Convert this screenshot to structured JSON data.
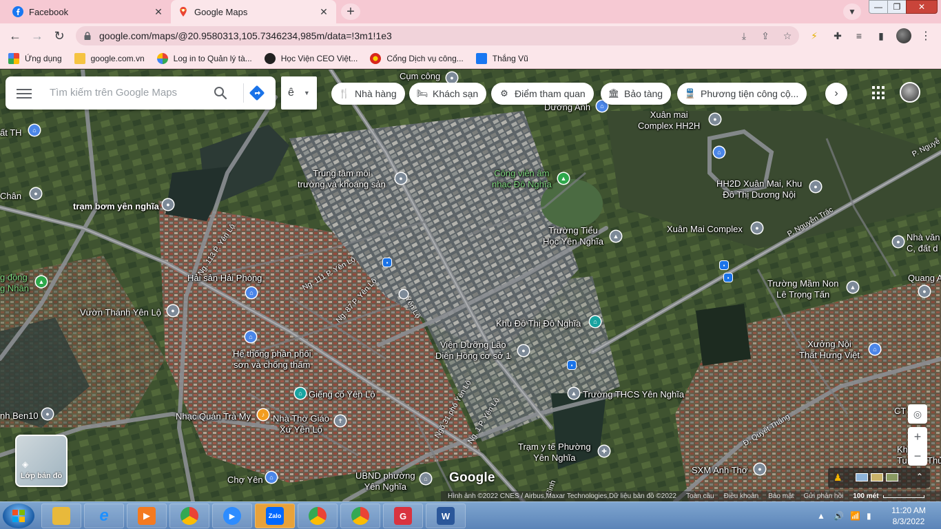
{
  "browser": {
    "tabs": [
      {
        "title": "Facebook",
        "active": false
      },
      {
        "title": "Google Maps",
        "active": true
      }
    ],
    "url": "google.com/maps/@20.9580313,105.7346234,985m/data=!3m1!1e3",
    "bookmarks": [
      {
        "label": "Ứng dụng",
        "icon": "apps-icon"
      },
      {
        "label": "google.com.vn",
        "icon": "folder-icon"
      },
      {
        "label": "Log in to Quản lý tà...",
        "icon": "pinwheel-icon"
      },
      {
        "label": "Học Viện CEO Việt...",
        "icon": "globe-icon"
      },
      {
        "label": "Cổng Dịch vụ công...",
        "icon": "star-emblem-icon"
      },
      {
        "label": "Thắng Vũ",
        "icon": "facebook-icon"
      }
    ]
  },
  "maps": {
    "search_placeholder": "Tìm kiếm trên Google Maps",
    "ime_label": "ê",
    "chips": [
      {
        "label": "Nhà hàng",
        "icon": "restaurant-icon"
      },
      {
        "label": "Khách sạn",
        "icon": "hotel-icon"
      },
      {
        "label": "Điểm tham quan",
        "icon": "attraction-icon"
      },
      {
        "label": "Bảo tàng",
        "icon": "museum-icon"
      },
      {
        "label": "Phương tiện công cộ...",
        "icon": "transit-icon"
      }
    ],
    "layers_label": "Lớp bản đồ",
    "logo": "Google",
    "attribution": {
      "imagery": "Hình ảnh ©2022 CNES / Airbus,Maxar Technologies,Dữ liệu bản đồ ©2022",
      "terms": "Toàn cầu",
      "tos": "Điều khoản",
      "privacy": "Bảo mật",
      "feedback": "Gửi phản hồi",
      "scale": "100 mét"
    },
    "places": [
      {
        "text": "Cụm công",
        "pin": "grey"
      },
      {
        "text": "Dương Anh",
        "pin": "blue"
      },
      {
        "text": "Xuân mai\nComplex HH2H",
        "pin": "grey"
      },
      {
        "text": "ất TH",
        "pin": "blue"
      },
      {
        "text": "Trung tâm môi\ntrường và khoáng sản",
        "pin": "grey"
      },
      {
        "text": "Công viên âm\nnhạc Đô Nghĩa",
        "pin": "green"
      },
      {
        "text": "HH2D Xuân Mai, Khu\nĐô Thị Dương Nội",
        "pin": "grey"
      },
      {
        "text": "Chân",
        "pin": "grey"
      },
      {
        "text": "trạm bơm yên nghĩa",
        "pin": "grey"
      },
      {
        "text": "Trường Tiểu\nHọc Yên Nghĩa",
        "pin": "grey"
      },
      {
        "text": "Xuân Mai Complex",
        "pin": "grey"
      },
      {
        "text": "Nhà văn\nC, đất d",
        "pin": "grey"
      },
      {
        "text": "g động\ng Nhân",
        "pin": "green"
      },
      {
        "text": "Hải sản Hải Phòng",
        "pin": "blue"
      },
      {
        "text": "Trường Mầm Non\nLê Trọng Tấn",
        "pin": "grey"
      },
      {
        "text": "Quang A",
        "pin": "grey"
      },
      {
        "text": "Vườn Thánh Yên Lộ",
        "pin": "grey"
      },
      {
        "text": "Khu Đô Thị Đô Nghĩa",
        "pin": "teal"
      },
      {
        "text": "Hệ thống phân phối\nsơn và chống thấm",
        "pin": "blue"
      },
      {
        "text": "Viện Dưỡng Lão\nDiên Hồng cơ sở 1",
        "pin": "grey"
      },
      {
        "text": "Xưởng Nội\nThất Hưng Việt",
        "pin": "blue"
      },
      {
        "text": "Giếng cổ Yên Lộ",
        "pin": "teal"
      },
      {
        "text": "Trường THCS Yên Nghĩa",
        "pin": "grey"
      },
      {
        "text": "nh Ben10",
        "pin": "grey"
      },
      {
        "text": "Nhạc Quán Trà My",
        "pin": "orange"
      },
      {
        "text": "Nhà Thờ Giáo\nXứ Yên Lộ",
        "pin": "grey"
      },
      {
        "text": "CT",
        "pin": "grey"
      },
      {
        "text": "Trạm y tế Phường\nYên Nghĩa",
        "pin": "grey"
      },
      {
        "text": "Kh\nTu L",
        "pin": "grey"
      },
      {
        "text": "Thủ",
        "pin": "grey"
      },
      {
        "text": "Chợ Yên",
        "pin": "blue"
      },
      {
        "text": "UBND phường\nYên Nghĩa",
        "pin": "grey"
      },
      {
        "text": "SXM Anh Thơ",
        "pin": "grey"
      }
    ],
    "roads": [
      "Ng. 113 P. Yên Lộ",
      "Ng. 111 P. Yên Lộ",
      "Ng. 87 P. Yên Lộ",
      "P. Yên Lộ",
      "P. Nguyễn Trác",
      "P. Nguyễ",
      "Ngõ 31 phố Yên Lộ",
      "Ng. 1 P. Yên Lộ",
      "Đ. Quyết Thắng",
      "Bình"
    ]
  },
  "taskbar": {
    "apps": [
      {
        "name": "file-explorer",
        "glyph": ""
      },
      {
        "name": "internet-explorer",
        "glyph": "e"
      },
      {
        "name": "media-player",
        "glyph": "▶"
      },
      {
        "name": "chrome-1",
        "glyph": ""
      },
      {
        "name": "zoom",
        "glyph": "▶"
      },
      {
        "name": "zalo",
        "glyph": "Zalo"
      },
      {
        "name": "chrome-2",
        "glyph": ""
      },
      {
        "name": "chrome-3",
        "glyph": ""
      },
      {
        "name": "greenshot",
        "glyph": "G"
      },
      {
        "name": "word",
        "glyph": "W"
      }
    ],
    "time": "11:20 AM",
    "date": "8/3/2022"
  },
  "colors": {
    "tab_bar": "#f6c9d3",
    "toolbar": "#fbe6ea",
    "taskbar": "#5b84b8",
    "pin_blue": "#4b86e8",
    "pin_grey": "#7d8a98",
    "pin_teal": "#19a3a0",
    "pin_green": "#2ea84b",
    "pin_orange": "#f29c1f"
  }
}
